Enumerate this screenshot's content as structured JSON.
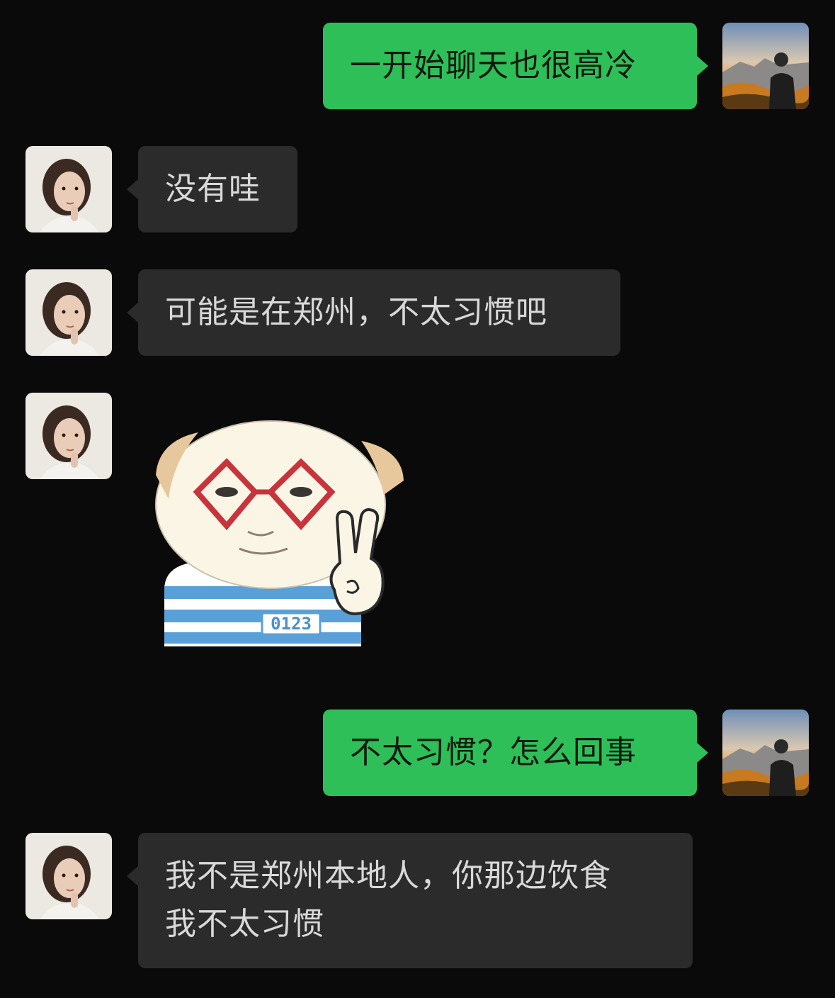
{
  "conversation": {
    "messages": [
      {
        "sender": "me",
        "text": "一开始聊天也很高冷"
      },
      {
        "sender": "her",
        "text": "没有哇"
      },
      {
        "sender": "her",
        "text": "可能是在郑州，不太习惯吧"
      },
      {
        "sender": "her",
        "sticker": "dog-with-glasses-peace-sign",
        "sticker_text": "0123"
      },
      {
        "sender": "me",
        "text": "不太习惯？怎么回事"
      },
      {
        "sender": "her",
        "text": "我不是郑州本地人，你那边饮食\n我不太习惯"
      }
    ]
  },
  "colors": {
    "background": "#0a0a0a",
    "outgoing_bubble": "#2fbf59",
    "incoming_bubble": "#2b2b2b"
  },
  "icons": {
    "my_avatar": "mountain-sunrise-person-avatar",
    "her_avatar": "woman-portrait-avatar"
  }
}
